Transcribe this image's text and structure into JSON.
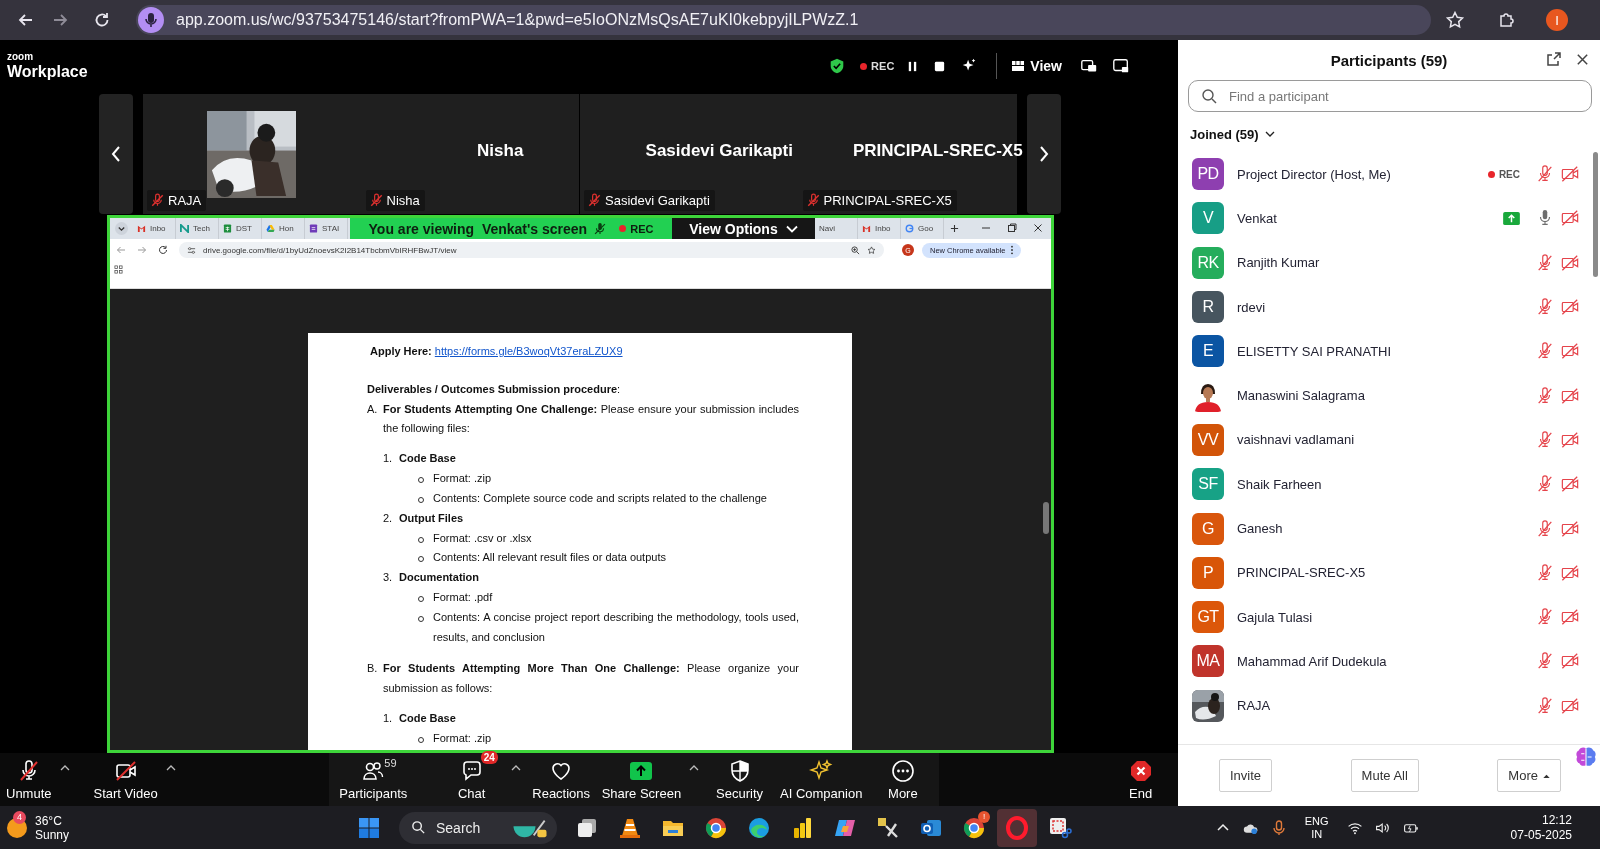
{
  "browser": {
    "url": "app.zoom.us/wc/93753475146/start?fromPWA=1&pwd=e5IoONzMsQsAE7uKI0kebpyjILPWzZ.1",
    "profile_initial": "I"
  },
  "zoom_header": {
    "logo_top": "zoom",
    "logo_bottom": "Workplace",
    "recording": "REC",
    "view_label": "View"
  },
  "thumbnails": [
    {
      "kind": "picture",
      "label": "RAJA",
      "muted": true
    },
    {
      "kind": "name",
      "name": "Nisha",
      "label": "Nisha",
      "muted": true
    },
    {
      "kind": "name",
      "name": "Sasidevi Garikapti",
      "label": "Sasidevi Garikapti",
      "muted": true
    },
    {
      "kind": "name",
      "name": "PRINCIPAL-SREC-X5",
      "label": "PRINCIPAL-SREC-X5",
      "muted": true
    }
  ],
  "shared_screen": {
    "banner": "You are viewing  Venkat's screen",
    "banner_muted": true,
    "rec": "REC",
    "view_options": "View Options",
    "tabs_left": [
      {
        "kind": "mail",
        "label": "Inbo"
      },
      {
        "kind": "n",
        "label": "Tech"
      },
      {
        "kind": "sheet",
        "label": "DST"
      },
      {
        "kind": "drive",
        "label": "Hon"
      },
      {
        "kind": "form",
        "label": "STAI"
      }
    ],
    "tabs_right": [
      {
        "kind": "none",
        "label": "Navi"
      },
      {
        "kind": "mail",
        "label": "Inbo"
      },
      {
        "kind": "google",
        "label": "Goo"
      }
    ],
    "url": "drive.google.com/file/d/1byUdZnoevsK2I2B14TbcbmVbIRHFBwJT/view",
    "profile_initial": "G",
    "chrome_notice": "New Chrome available",
    "document": {
      "apply_label": "**Apply Here:**",
      "apply_link": "https://forms.gle/B3woqVt37eraLZUX9",
      "heading": "**Deliverables / Outcomes Submission procedure**:",
      "sections": [
        {
          "marker": "A.",
          "text": "**For Students Attempting One Challenge:** Please ensure your submission includes the following files:",
          "items": [
            {
              "marker": "1.",
              "title": "Code Base",
              "bullets": [
                "Format: .zip",
                "Contents: Complete source code and scripts related to the challenge"
              ]
            },
            {
              "marker": "2.",
              "title": "Output Files",
              "bullets": [
                "Format: .csv or .xlsx",
                "Contents: All relevant result files or data outputs"
              ]
            },
            {
              "marker": "3.",
              "title": "Documentation",
              "bullets": [
                "Format: .pdf",
                "Contents: A concise project report describing the methodology, tools used, results, and conclusion"
              ]
            }
          ]
        },
        {
          "marker": "B.",
          "text": "**For Students Attempting More Than One Challenge:** Please organize your submission as follows:",
          "items": [
            {
              "marker": "1.",
              "title": "Code Base",
              "bullets": [
                "Format: .zip"
              ]
            }
          ]
        }
      ]
    }
  },
  "toolbar": {
    "left": [
      {
        "kind": "mic",
        "label": "Unmute",
        "muted": true,
        "caret": true
      },
      {
        "kind": "video",
        "label": "Start Video",
        "video_on": false,
        "caret": true
      }
    ],
    "center": [
      {
        "kind": "participants",
        "label": "Participants",
        "count": "59",
        "caret": false
      },
      {
        "kind": "chat",
        "label": "Chat",
        "badge": "24",
        "caret": true
      },
      {
        "kind": "reactions",
        "label": "Reactions",
        "caret": false
      },
      {
        "kind": "share",
        "label": "Share Screen",
        "caret": true
      },
      {
        "kind": "security",
        "label": "Security",
        "caret": false
      },
      {
        "kind": "ai",
        "label": "AI Companion",
        "caret": false
      },
      {
        "kind": "more",
        "label": "More",
        "caret": false
      }
    ],
    "end_label": "End"
  },
  "participants_panel": {
    "title": "Participants (59)",
    "search_placeholder": "Find a participant",
    "group_label": "Joined (59)",
    "group_expanded": true,
    "rows": [
      {
        "kind": "initials",
        "initials": "PD",
        "color": "#8e3fb0",
        "name": "Project Director (Host, Me)",
        "indicator": {
          "kind": "rec",
          "label": "REC"
        },
        "muted": true,
        "video_on": false
      },
      {
        "kind": "initials",
        "initials": "V",
        "color": "#179e86",
        "name": "Venkat",
        "indicator": {
          "kind": "sharing"
        },
        "muted": false,
        "video_on": false
      },
      {
        "kind": "initials",
        "initials": "RK",
        "color": "#25ad5c",
        "name": "Ranjith Kumar",
        "muted": true,
        "video_on": false
      },
      {
        "kind": "initials",
        "initials": "R",
        "color": "#47555f",
        "name": "rdevi",
        "muted": true,
        "video_on": false
      },
      {
        "kind": "initials",
        "initials": "E",
        "color": "#0b55a3",
        "name": "ELISETTY SAI PRANATHI",
        "muted": true,
        "video_on": false
      },
      {
        "name": "Manaswini Salagrama",
        "muted": true,
        "video_on": false
      },
      {
        "kind": "initials",
        "initials": "VV",
        "color": "#d25408",
        "name": "vaishnavi vadlamani",
        "muted": true,
        "video_on": false
      },
      {
        "kind": "initials",
        "initials": "SF",
        "color": "#17a286",
        "name": "Shaik Farheen",
        "muted": true,
        "video_on": false
      },
      {
        "kind": "initials",
        "initials": "G",
        "color": "#d9560c",
        "name": "Ganesh",
        "muted": true,
        "video_on": false
      },
      {
        "kind": "initials",
        "initials": "P",
        "color": "#d85508",
        "name": "PRINCIPAL-SREC-X5",
        "muted": true,
        "video_on": false
      },
      {
        "kind": "initials",
        "initials": "GT",
        "color": "#dc570a",
        "name": "Gajula Tulasi",
        "muted": true,
        "video_on": false
      },
      {
        "kind": "initials",
        "initials": "MA",
        "color": "#c0342b",
        "name": "Mahammad Arif Dudekula",
        "muted": true,
        "video_on": false
      },
      {
        "name": "RAJA",
        "muted": true,
        "video_on": false
      }
    ],
    "buttons": [
      "Invite",
      "Mute All",
      "More"
    ]
  },
  "taskbar": {
    "weather_badge": "4",
    "temperature": "36°C",
    "condition": "Sunny",
    "search_label": "Search",
    "app_badge": "!",
    "language": "ENG",
    "region": "IN",
    "time": "12:12",
    "date": "07-05-2025"
  }
}
